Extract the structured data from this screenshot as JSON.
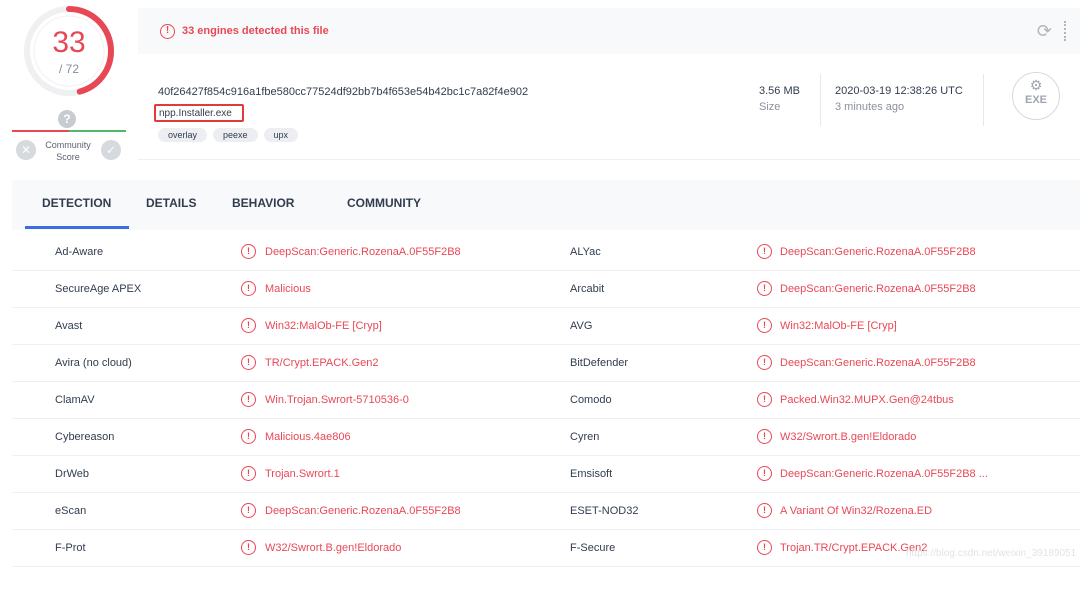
{
  "score": {
    "detected": "33",
    "total": "/ 72",
    "detect_fraction": 0.458
  },
  "community": {
    "label": "Community Score",
    "question": "?",
    "reject": "✕",
    "accept": "✓"
  },
  "alert": {
    "text": "33 engines detected this file",
    "icon": "!"
  },
  "file": {
    "hash": "40f26427f854c916a1fbe580cc77524df92bb7b4f653e54b42bc1c7a82f4e902",
    "name": "npp.Installer.exe",
    "tags": [
      "overlay",
      "peexe",
      "upx"
    ],
    "size_value": "3.56 MB",
    "size_label": "Size",
    "date_value": "2020-03-19 12:38:26 UTC",
    "date_label": "3 minutes ago",
    "type_label": "EXE"
  },
  "tabs": [
    "DETECTION",
    "DETAILS",
    "BEHAVIOR",
    "COMMUNITY"
  ],
  "rows": [
    {
      "engine1": "Ad-Aware",
      "result1": "DeepScan:Generic.RozenaA.0F55F2B8",
      "engine2": "ALYac",
      "result2": "DeepScan:Generic.RozenaA.0F55F2B8"
    },
    {
      "engine1": "SecureAge APEX",
      "result1": "Malicious",
      "engine2": "Arcabit",
      "result2": "DeepScan:Generic.RozenaA.0F55F2B8"
    },
    {
      "engine1": "Avast",
      "result1": "Win32:MalOb-FE [Cryp]",
      "engine2": "AVG",
      "result2": "Win32:MalOb-FE [Cryp]"
    },
    {
      "engine1": "Avira (no cloud)",
      "result1": "TR/Crypt.EPACK.Gen2",
      "engine2": "BitDefender",
      "result2": "DeepScan:Generic.RozenaA.0F55F2B8"
    },
    {
      "engine1": "ClamAV",
      "result1": "Win.Trojan.Swrort-5710536-0",
      "engine2": "Comodo",
      "result2": "Packed.Win32.MUPX.Gen@24tbus"
    },
    {
      "engine1": "Cybereason",
      "result1": "Malicious.4ae806",
      "engine2": "Cyren",
      "result2": "W32/Swrort.B.gen!Eldorado"
    },
    {
      "engine1": "DrWeb",
      "result1": "Trojan.Swrort.1",
      "engine2": "Emsisoft",
      "result2": "DeepScan:Generic.RozenaA.0F55F2B8 ..."
    },
    {
      "engine1": "eScan",
      "result1": "DeepScan:Generic.RozenaA.0F55F2B8",
      "engine2": "ESET-NOD32",
      "result2": "A Variant Of Win32/Rozena.ED"
    },
    {
      "engine1": "F-Prot",
      "result1": "W32/Swrort.B.gen!Eldorado",
      "engine2": "F-Secure",
      "result2": "Trojan.TR/Crypt.EPACK.Gen2"
    }
  ],
  "watermark": "https://blog.csdn.net/weixin_39189051",
  "colors": {
    "danger": "#e84856",
    "ok": "#4eb86b",
    "tab_accent": "#3a6fe0"
  }
}
